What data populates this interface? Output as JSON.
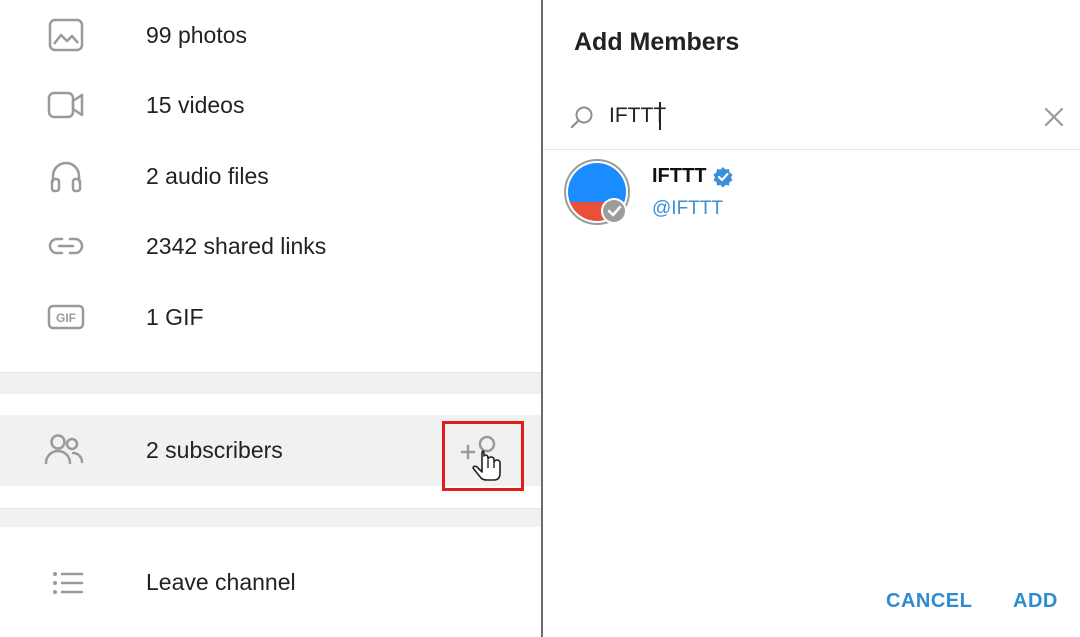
{
  "media": {
    "items": [
      {
        "icon": "photo-icon",
        "label": "99 photos"
      },
      {
        "icon": "video-icon",
        "label": "15 videos"
      },
      {
        "icon": "headphones-icon",
        "label": "2 audio files"
      },
      {
        "icon": "link-icon",
        "label": "2342 shared links"
      },
      {
        "icon": "gif-icon",
        "label": "1 GIF"
      }
    ]
  },
  "subscribers": {
    "label": "2 subscribers",
    "icon": "people-icon",
    "add_icon": "add-member-icon"
  },
  "leave": {
    "label": "Leave channel",
    "icon": "list-icon"
  },
  "dialog": {
    "title": "Add Members",
    "search": {
      "value": "IFTTT",
      "icon": "search-icon",
      "clear_icon": "close-icon"
    },
    "results": [
      {
        "name": "IFTTT",
        "handle": "@IFTTT",
        "verified": true
      }
    ],
    "cancel_label": "CANCEL",
    "add_label": "ADD"
  },
  "colors": {
    "accent": "#2f8ccf",
    "highlight_box": "#e21b1b",
    "avatar_blue": "#1a8cff",
    "avatar_red": "#e9503a"
  }
}
